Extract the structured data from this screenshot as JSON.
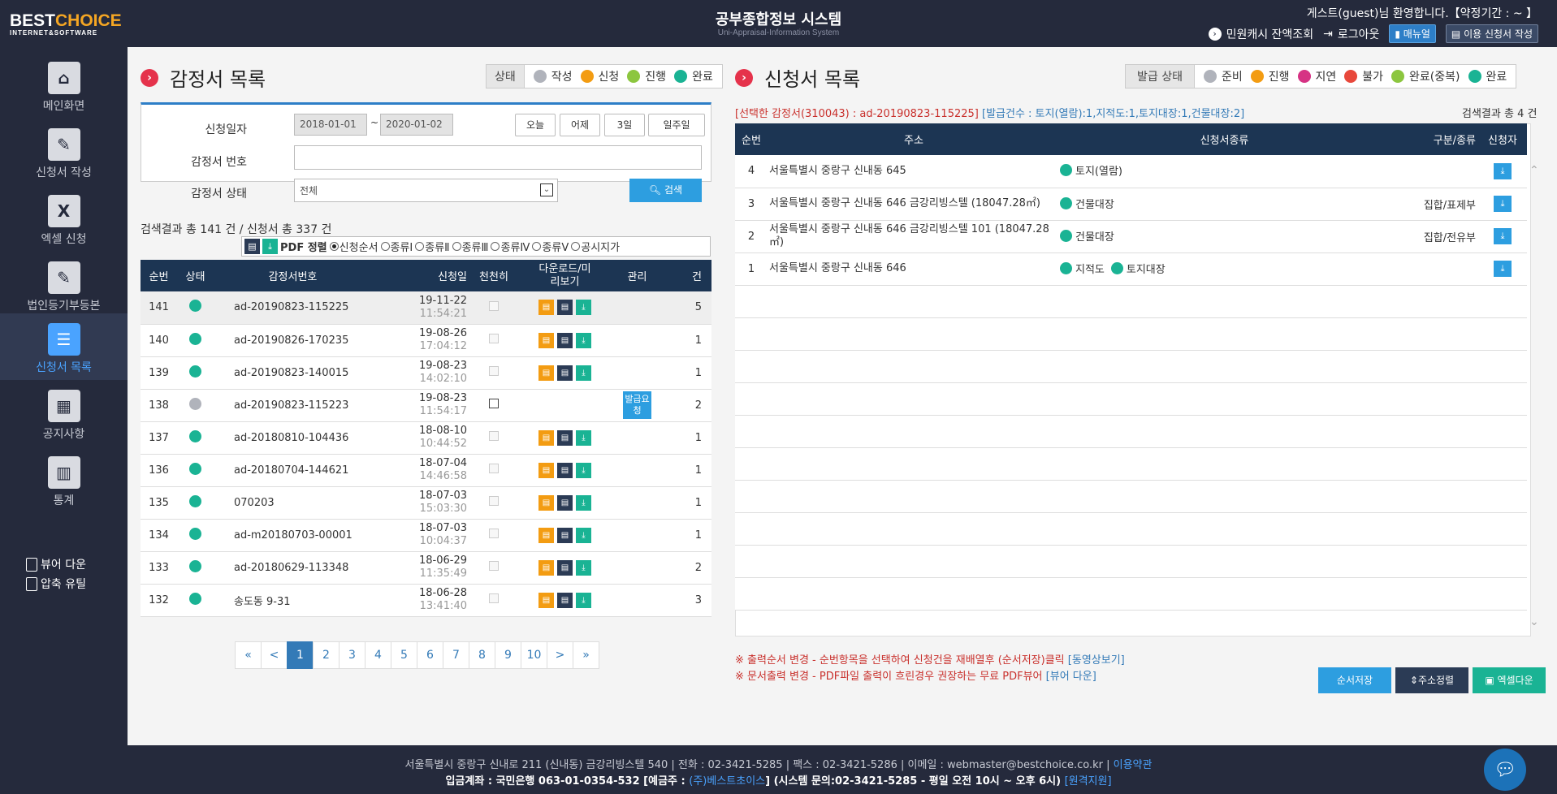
{
  "header": {
    "logo_main": "BEST",
    "logo_accent": "CHOICE",
    "logo_sub": "INTERNET&SOFTWARE",
    "title": "공부종합정보 시스템",
    "subtitle": "Uni-Appraisal-Information System",
    "welcome": "게스트(guest)님 환영합니다.【약정기간 : ~ 】",
    "cash": "민원캐시 잔액조회",
    "logout": "로그아웃",
    "manual": "매뉴얼",
    "guide": "이용 신청서 작성"
  },
  "sidebar": {
    "items": [
      {
        "label": "메인화면",
        "icon": "home-icon"
      },
      {
        "label": "신청서 작성",
        "icon": "pencil-icon"
      },
      {
        "label": "엑셀 신청",
        "icon": "excel-icon"
      },
      {
        "label": "법인등기부등본",
        "icon": "pencil-icon"
      },
      {
        "label": "신청서 목록",
        "icon": "list-icon"
      },
      {
        "label": "공지사항",
        "icon": "newspaper-icon"
      },
      {
        "label": "통계",
        "icon": "bar-chart-icon"
      }
    ],
    "viewer": "뷰어 다운",
    "zip": "압축 유틸"
  },
  "left": {
    "title": "감정서 목록",
    "legend_label": "상태",
    "legend": [
      {
        "label": "작성",
        "color": "#b0b3bb"
      },
      {
        "label": "신청",
        "color": "#f39c12"
      },
      {
        "label": "진행",
        "color": "#8cc63f"
      },
      {
        "label": "완료",
        "color": "#1ab394"
      }
    ],
    "search": {
      "date_label": "신청일자",
      "date_from": "2018-01-01",
      "tilde": "~",
      "date_to": "2020-01-02",
      "quick": [
        "오늘",
        "어제",
        "3일",
        "일주일"
      ],
      "no_label": "감정서 번호",
      "status_label": "감정서 상태",
      "status_value": "전체",
      "search_btn": "검색"
    },
    "count": "검색결과 총 141 건 / 신청서 총 337 건",
    "sort_label": "PDF 정렬",
    "sort_options": [
      "신청순서",
      "종류Ⅰ",
      "종류Ⅱ",
      "종류Ⅲ",
      "종류Ⅳ",
      "종류Ⅴ",
      "공시지가"
    ],
    "columns": [
      "순번",
      "상태",
      "감정서번호",
      "신청일",
      "천천히",
      "다운로드/미리보기",
      "관리",
      "건"
    ],
    "rows": [
      {
        "no": "141",
        "status": "#1ab394",
        "id": "ad-20190823-115225",
        "date": "19-11-22",
        "time": "11:54:21",
        "icons": true,
        "manage": "",
        "count": "5"
      },
      {
        "no": "140",
        "status": "#1ab394",
        "id": "ad-20190826-170235",
        "date": "19-08-26",
        "time": "17:04:12",
        "icons": true,
        "manage": "",
        "count": "1"
      },
      {
        "no": "139",
        "status": "#1ab394",
        "id": "ad-20190823-140015",
        "date": "19-08-23",
        "time": "14:02:10",
        "icons": true,
        "manage": "",
        "count": "1"
      },
      {
        "no": "138",
        "status": "#b0b3bb",
        "id": "ad-20190823-115223",
        "date": "19-08-23",
        "time": "11:54:17",
        "icons": false,
        "manage": "발급요청",
        "count": "2"
      },
      {
        "no": "137",
        "status": "#1ab394",
        "id": "ad-20180810-104436",
        "date": "18-08-10",
        "time": "10:44:52",
        "icons": true,
        "manage": "",
        "count": "1"
      },
      {
        "no": "136",
        "status": "#1ab394",
        "id": "ad-20180704-144621",
        "date": "18-07-04",
        "time": "14:46:58",
        "icons": true,
        "manage": "",
        "count": "1"
      },
      {
        "no": "135",
        "status": "#1ab394",
        "id": "070203",
        "date": "18-07-03",
        "time": "15:03:30",
        "icons": true,
        "manage": "",
        "count": "1"
      },
      {
        "no": "134",
        "status": "#1ab394",
        "id": "ad-m20180703-00001",
        "date": "18-07-03",
        "time": "10:04:37",
        "icons": true,
        "manage": "",
        "count": "1"
      },
      {
        "no": "133",
        "status": "#1ab394",
        "id": "ad-20180629-113348",
        "date": "18-06-29",
        "time": "11:35:49",
        "icons": true,
        "manage": "",
        "count": "2"
      },
      {
        "no": "132",
        "status": "#1ab394",
        "id": "송도동 9-31",
        "date": "18-06-28",
        "time": "13:41:40",
        "icons": true,
        "manage": "",
        "count": "3"
      }
    ],
    "pager": [
      "«",
      "<",
      "1",
      "2",
      "3",
      "4",
      "5",
      "6",
      "7",
      "8",
      "9",
      "10",
      ">",
      "»"
    ],
    "current_page": "1"
  },
  "right": {
    "title": "신청서 목록",
    "legend_label": "발급 상태",
    "legend": [
      {
        "label": "준비",
        "color": "#b0b3bb"
      },
      {
        "label": "진행",
        "color": "#f39c12"
      },
      {
        "label": "지연",
        "color": "#d63384"
      },
      {
        "label": "불가",
        "color": "#e8483b"
      },
      {
        "label": "완료(중복)",
        "color": "#8cc63f"
      },
      {
        "label": "완료",
        "color": "#1ab394"
      }
    ],
    "info_selected": "[선택한 감정서(310043) : ad-20190823-115225]",
    "info_count": "[발급건수 : 토지(열람):1,지적도:1,토지대장:1,건물대장:2]",
    "total": "검색결과 총 4 건",
    "columns": [
      "순번",
      "주소",
      "신청서종류",
      "구분/종류",
      "신청자"
    ],
    "rows": [
      {
        "no": "4",
        "addr": "서울특별시 중랑구 신내동 645",
        "kinds": [
          "토지(열람)"
        ],
        "cat": ""
      },
      {
        "no": "3",
        "addr": "서울특별시 중랑구 신내동 646 금강리빙스텔 (18047.28㎡)",
        "kinds": [
          "건물대장"
        ],
        "cat": "집합/표제부"
      },
      {
        "no": "2",
        "addr": "서울특별시 중랑구 신내동 646 금강리빙스텔 101 (18047.28㎡)",
        "kinds": [
          "건물대장"
        ],
        "cat": "집합/전유부"
      },
      {
        "no": "1",
        "addr": "서울특별시 중랑구 신내동 646",
        "kinds": [
          "지적도",
          "토지대장"
        ],
        "cat": ""
      }
    ],
    "note1": "※ 출력순서 변경 - 순번항목을 선택하여 신청건을 재배열후 (순서저장)클릭",
    "note1_link": "[동영상보기]",
    "note2": "※ 문서출력 변경 - PDF파일 출력이 흐린경우 권장하는 무료 PDF뷰어",
    "note2_link": "[뷰어 다운]",
    "btn_save": "순서저장",
    "btn_sort": "주소정렬",
    "btn_excel": "엑셀다운"
  },
  "footer": {
    "line1": "서울특별시 중랑구 신내로 211 (신내동) 금강리빙스텔 540 | 전화 : 02-3421-5285 | 팩스 : 02-3421-5286 | 이메일 : webmaster@bestchoice.co.kr |",
    "terms": "이용약관",
    "line2": "입금계좌 : 국민은행 063-01-0354-532 [예금주 :",
    "company": "(주)베스트초이스",
    "line2b": "] (시스템 문의:02-3421-5285 - 평일 오전 10시 ~ 오후 6시)",
    "remote": "[원격지원]"
  }
}
